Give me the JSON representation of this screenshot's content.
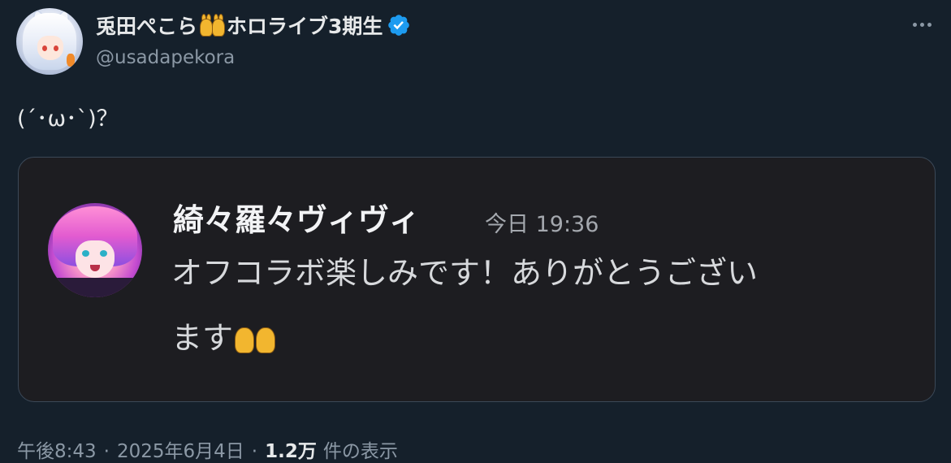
{
  "author": {
    "display_name_part1": "兎田ぺこら",
    "display_name_part2": "ホロライブ3期生",
    "emoji_icon": "bunny-girls-emoji",
    "handle": "@usadapekora",
    "verified": true
  },
  "tweet": {
    "text": "(´･ω･`)？"
  },
  "attached_image": {
    "sender_name": "綺々羅々ヴィヴィ",
    "timestamp": "今日 19:36",
    "message_line1": "オフコラボ楽しみです！ありがとうござい",
    "message_line2": "ます"
  },
  "footer": {
    "time": "午後8:43",
    "date": "2025年6月4日",
    "views_count": "1.2万",
    "views_label": "件の表示",
    "separator": "·"
  },
  "colors": {
    "background": "#15202b",
    "primary_text": "#e7e9ea",
    "secondary_text": "#8b98a5",
    "verified_blue": "#1d9bf0",
    "card_bg": "#1d1d21"
  }
}
